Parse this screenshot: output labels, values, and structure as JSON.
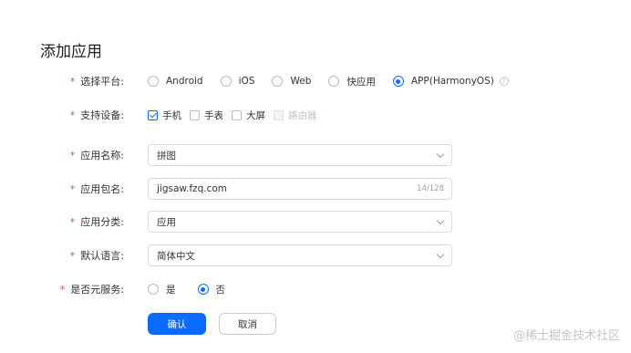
{
  "page": {
    "title": "添加应用"
  },
  "form": {
    "platform": {
      "label": "选择平台:",
      "options": [
        "Android",
        "iOS",
        "Web",
        "快应用",
        "APP(HarmonyOS)"
      ],
      "selected": "APP(HarmonyOS)",
      "help": "?"
    },
    "devices": {
      "label": "支持设备:",
      "options": [
        "手机",
        "手表",
        "大屏",
        "路由器"
      ],
      "checked": [
        "手机"
      ],
      "disabled": [
        "路由器"
      ]
    },
    "app_name": {
      "label": "应用名称:",
      "value": "拼图"
    },
    "package_name": {
      "label": "应用包名:",
      "value": "jigsaw.fzq.com",
      "counter": "14/128"
    },
    "category": {
      "label": "应用分类:",
      "value": "应用"
    },
    "language": {
      "label": "默认语言:",
      "value": "简体中文"
    },
    "meta_service": {
      "label": "是否元服务:",
      "options": [
        "是",
        "否"
      ],
      "selected": "否"
    },
    "required_mark": "*"
  },
  "buttons": {
    "confirm": "确认",
    "cancel": "取消"
  },
  "watermark": "@稀土掘金技术社区",
  "colors": {
    "primary": "#0a6cff",
    "required": "#e84a4a"
  }
}
